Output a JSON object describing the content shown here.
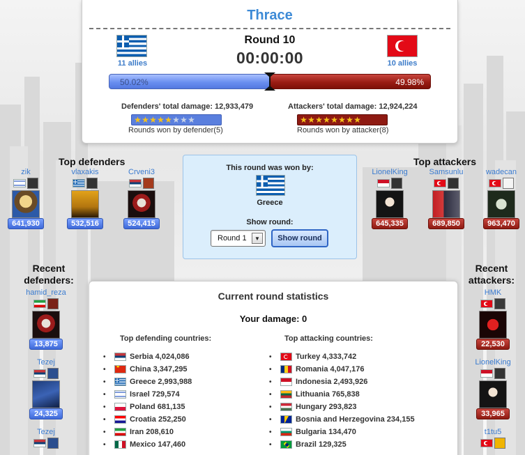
{
  "battle": {
    "region": "Thrace",
    "round_title": "Round 10",
    "timer": "00:00:00",
    "defender": {
      "country": "Greece",
      "flag": "gr",
      "allies": "11 allies"
    },
    "attacker": {
      "country": "Turkey",
      "flag": "tr",
      "allies": "10 allies"
    },
    "defender_percent": 50.02,
    "defender_percent_label": "50.02%",
    "attacker_percent_label": "49.98%",
    "defender_damage_label": "Defenders' total damage: 12,933,479",
    "attacker_damage_label": "Attackers' total damage: 12,924,224",
    "defender_rounds_won": 5,
    "attacker_rounds_won": 8,
    "rounds_to_win": 8,
    "defender_rounds_label": "Rounds won by defender(5)",
    "attacker_rounds_label": "Rounds won by attacker(8)",
    "colors": {
      "title": "#3d8ad6",
      "defender": "#5a7fde",
      "attacker": "#8e1a12"
    }
  },
  "top_defenders": {
    "title": "Top defenders",
    "items": [
      {
        "name": "zik",
        "flag": "il",
        "damage": "641,930"
      },
      {
        "name": "vlaxakis",
        "flag": "gr",
        "damage": "532,516"
      },
      {
        "name": "Crveni3",
        "flag": "rs",
        "damage": "524,415"
      }
    ]
  },
  "top_attackers": {
    "title": "Top attackers",
    "items": [
      {
        "name": "LionelKing",
        "flag": "id",
        "damage": "645,335"
      },
      {
        "name": "Samsunlu",
        "flag": "tr",
        "damage": "689,850"
      },
      {
        "name": "wadecan",
        "flag": "tr",
        "damage": "963,470"
      }
    ]
  },
  "round_box": {
    "won_label": "This round was won by:",
    "winner": "Greece",
    "winner_flag": "gr",
    "show_round_label": "Show round:",
    "selected_round": "Round 1",
    "show_button": "Show round"
  },
  "recent_defenders": {
    "title_line1": "Recent",
    "title_line2": "defenders:",
    "items": [
      {
        "name": "hamid_reza",
        "flag": "ir",
        "damage": "13,875"
      },
      {
        "name": "Tezej",
        "flag": "rs",
        "damage": "24,325"
      },
      {
        "name": "Tezej",
        "flag": "rs",
        "damage": ""
      }
    ]
  },
  "recent_attackers": {
    "title_line1": "Recent",
    "title_line2": "attackers:",
    "items": [
      {
        "name": "HMK",
        "flag": "tr",
        "damage": "22,530"
      },
      {
        "name": "LionelKing",
        "flag": "id",
        "damage": "33,965"
      },
      {
        "name": "t1tu5",
        "flag": "tr",
        "damage": ""
      }
    ]
  },
  "stats": {
    "title": "Current round statistics",
    "your_damage": "Your damage: 0",
    "defending_title": "Top defending countries:",
    "attacking_title": "Top attacking countries:",
    "defending": [
      {
        "flag": "rs",
        "text": "Serbia 4,024,086"
      },
      {
        "flag": "cn",
        "text": "China 3,347,295"
      },
      {
        "flag": "gr",
        "text": "Greece 2,993,988"
      },
      {
        "flag": "il",
        "text": "Israel 729,574"
      },
      {
        "flag": "pl",
        "text": "Poland 681,135"
      },
      {
        "flag": "hr",
        "text": "Croatia 252,250"
      },
      {
        "flag": "ir",
        "text": "Iran 208,610"
      },
      {
        "flag": "mx",
        "text": "Mexico 147,460"
      }
    ],
    "attacking": [
      {
        "flag": "tr",
        "text": "Turkey 4,333,742"
      },
      {
        "flag": "ro",
        "text": "Romania 4,047,176"
      },
      {
        "flag": "id",
        "text": "Indonesia 2,493,926"
      },
      {
        "flag": "lt",
        "text": "Lithuania 765,838"
      },
      {
        "flag": "hu",
        "text": "Hungary 293,823"
      },
      {
        "flag": "ba",
        "text": "Bosnia and Herzegovina 234,155"
      },
      {
        "flag": "bg",
        "text": "Bulgaria 134,470"
      },
      {
        "flag": "br",
        "text": "Brazil 129,325"
      }
    ]
  }
}
